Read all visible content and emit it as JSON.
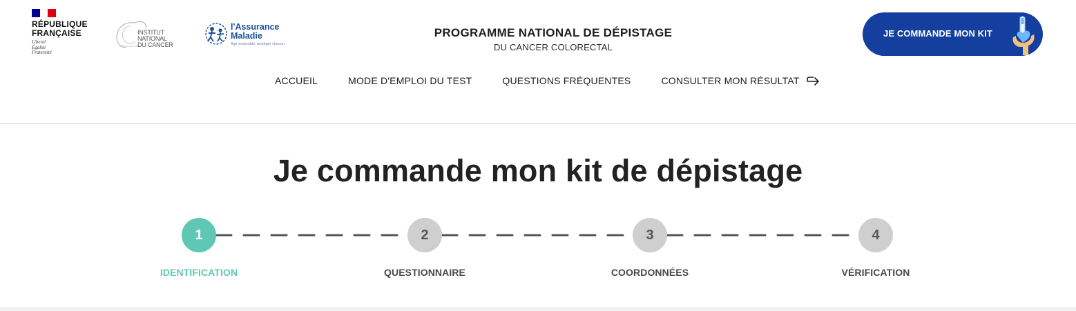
{
  "header": {
    "republique": {
      "name_line1": "RÉPUBLIQUE",
      "name_line2": "FRANÇAISE",
      "motto_line1": "Liberté",
      "motto_line2": "Égalité",
      "motto_line3": "Fraternité"
    },
    "inca": {
      "line1": "INSTITUT",
      "line2": "NATIONAL",
      "line3": "DU CANCER"
    },
    "assurance_maladie": {
      "line1": "l'Assurance",
      "line2": "Maladie",
      "tagline": "Agir ensemble, protéger chacun"
    },
    "program_title": "PROGRAMME NATIONAL DE DÉPISTAGE",
    "program_subtitle": "DU CANCER COLORECTAL",
    "order_button_label": "JE COMMANDE MON KIT",
    "nav": {
      "items": [
        {
          "label": "ACCUEIL"
        },
        {
          "label": "MODE D'EMPLOI DU TEST"
        },
        {
          "label": "QUESTIONS FRÉQUENTES"
        },
        {
          "label": "CONSULTER MON RÉSULTAT",
          "icon": "external-arrow-icon"
        }
      ]
    }
  },
  "main": {
    "title": "Je commande mon kit de dépistage",
    "stepper": {
      "current_step": 1,
      "steps": [
        {
          "number": "1",
          "label": "IDENTIFICATION",
          "state": "active"
        },
        {
          "number": "2",
          "label": "QUESTIONNAIRE",
          "state": "inactive"
        },
        {
          "number": "3",
          "label": "COORDONNÉES",
          "state": "inactive"
        },
        {
          "number": "4",
          "label": "VÉRIFICATION",
          "state": "inactive"
        }
      ]
    }
  },
  "colors": {
    "brand_blue": "#143f9f",
    "active_step": "#5ec8b5",
    "inactive_step": "#cfcfcf",
    "dash_line": "#555555",
    "text_dark": "#222222"
  }
}
